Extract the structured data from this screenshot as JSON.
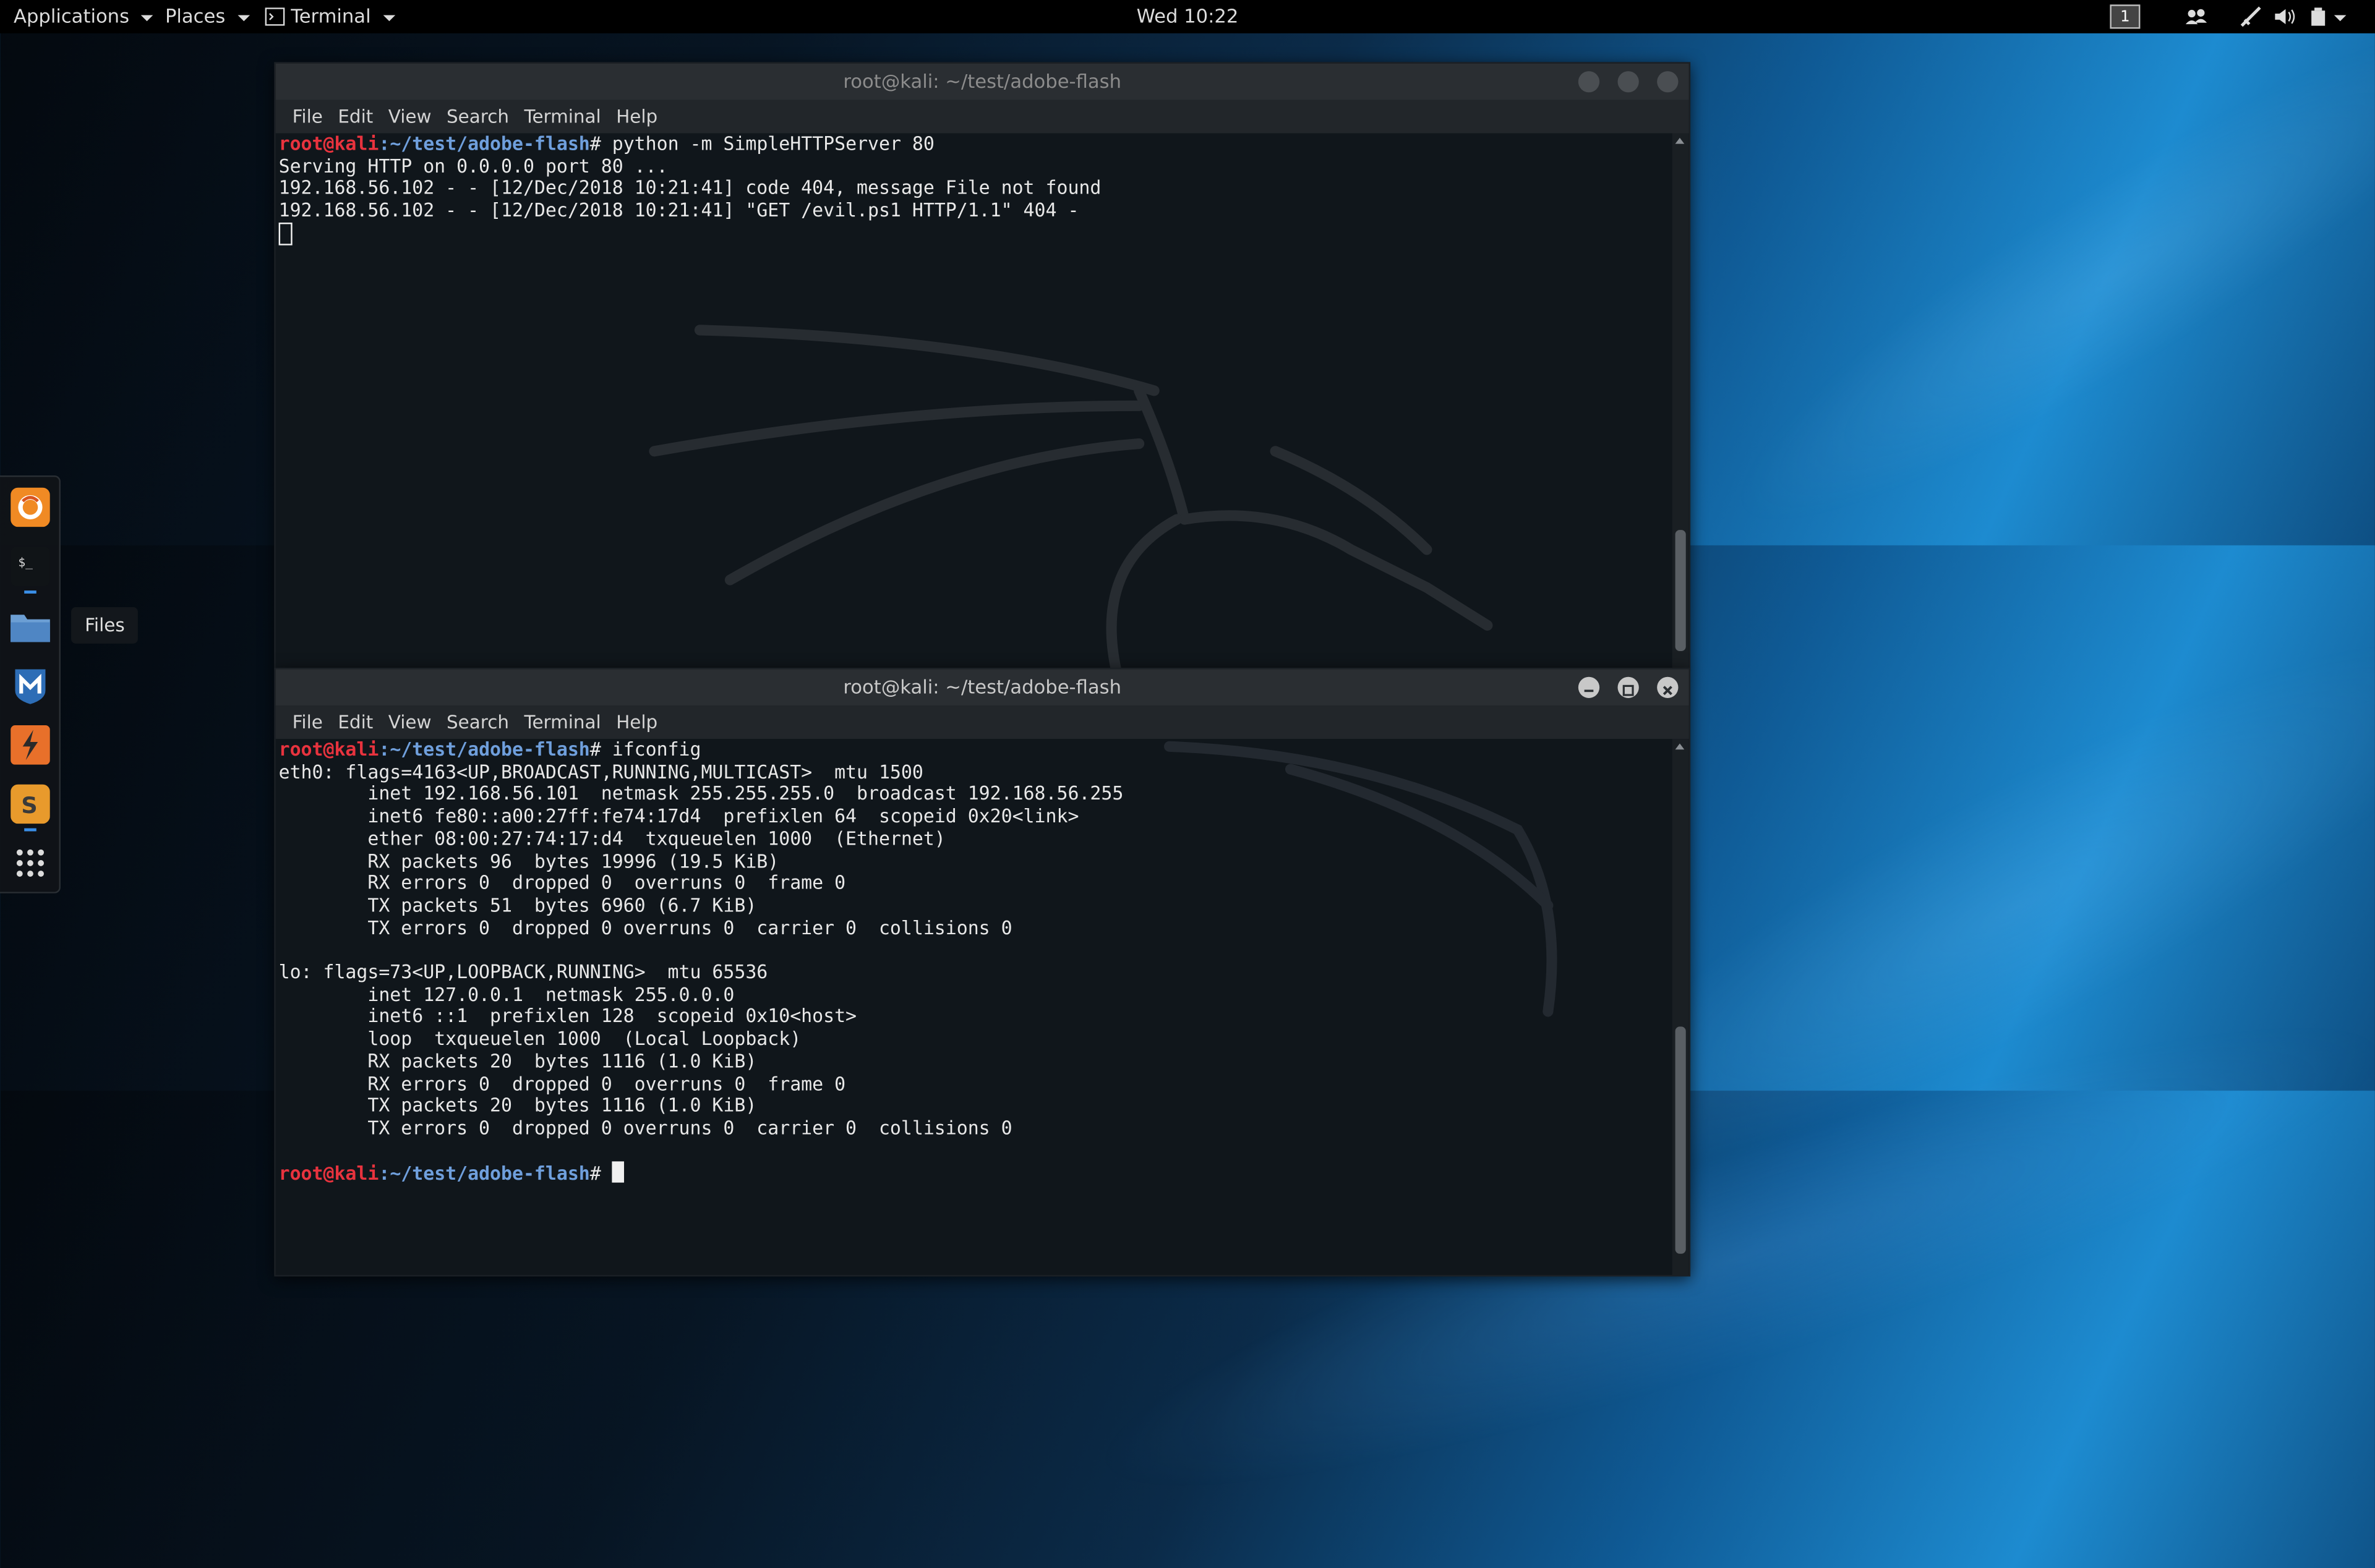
{
  "topbar": {
    "applications": "Applications",
    "places": "Places",
    "terminal": "Terminal",
    "clock": "Wed 10:22",
    "workspace": "1",
    "icons": [
      "people-icon",
      "network-icon",
      "volume-icon",
      "power-icon"
    ]
  },
  "dock": {
    "items": [
      "firefox",
      "terminal",
      "files",
      "metasploit",
      "burpsuite",
      "sublime-text",
      "show-applications"
    ],
    "tooltip": "Files"
  },
  "window_top": {
    "title": "root@kali: ~/test/adobe-flash",
    "menu": [
      "File",
      "Edit",
      "View",
      "Search",
      "Terminal",
      "Help"
    ],
    "prompt_user": "root@kali",
    "prompt_path": ":~/test/adobe-flash",
    "command": "# python -m SimpleHTTPServer 80",
    "output": [
      "Serving HTTP on 0.0.0.0 port 80 ...",
      "192.168.56.102 - - [12/Dec/2018 10:21:41] code 404, message File not found",
      "192.168.56.102 - - [12/Dec/2018 10:21:41] \"GET /evil.ps1 HTTP/1.1\" 404 -"
    ]
  },
  "window_bottom": {
    "title": "root@kali: ~/test/adobe-flash",
    "menu": [
      "File",
      "Edit",
      "View",
      "Search",
      "Terminal",
      "Help"
    ],
    "prompt_user": "root@kali",
    "prompt_path": ":~/test/adobe-flash",
    "command": "# ifconfig",
    "output": [
      "eth0: flags=4163<UP,BROADCAST,RUNNING,MULTICAST>  mtu 1500",
      "        inet 192.168.56.101  netmask 255.255.255.0  broadcast 192.168.56.255",
      "        inet6 fe80::a00:27ff:fe74:17d4  prefixlen 64  scopeid 0x20<link>",
      "        ether 08:00:27:74:17:d4  txqueuelen 1000  (Ethernet)",
      "        RX packets 96  bytes 19996 (19.5 KiB)",
      "        RX errors 0  dropped 0  overruns 0  frame 0",
      "        TX packets 51  bytes 6960 (6.7 KiB)",
      "        TX errors 0  dropped 0 overruns 0  carrier 0  collisions 0",
      "",
      "lo: flags=73<UP,LOOPBACK,RUNNING>  mtu 65536",
      "        inet 127.0.0.1  netmask 255.0.0.0",
      "        inet6 ::1  prefixlen 128  scopeid 0x10<host>",
      "        loop  txqueuelen 1000  (Local Loopback)",
      "        RX packets 20  bytes 1116 (1.0 KiB)",
      "        RX errors 0  dropped 0  overruns 0  frame 0",
      "        TX packets 20  bytes 1116 (1.0 KiB)",
      "        TX errors 0  dropped 0 overruns 0  carrier 0  collisions 0",
      ""
    ],
    "final_prompt_suffix": "# "
  },
  "colors": {
    "prompt_user": "#e8333e",
    "prompt_path": "#6f9fdc",
    "terminal_bg": "#10161b",
    "titlebar": "#2a2e32",
    "accent": "#3a8ee6"
  }
}
